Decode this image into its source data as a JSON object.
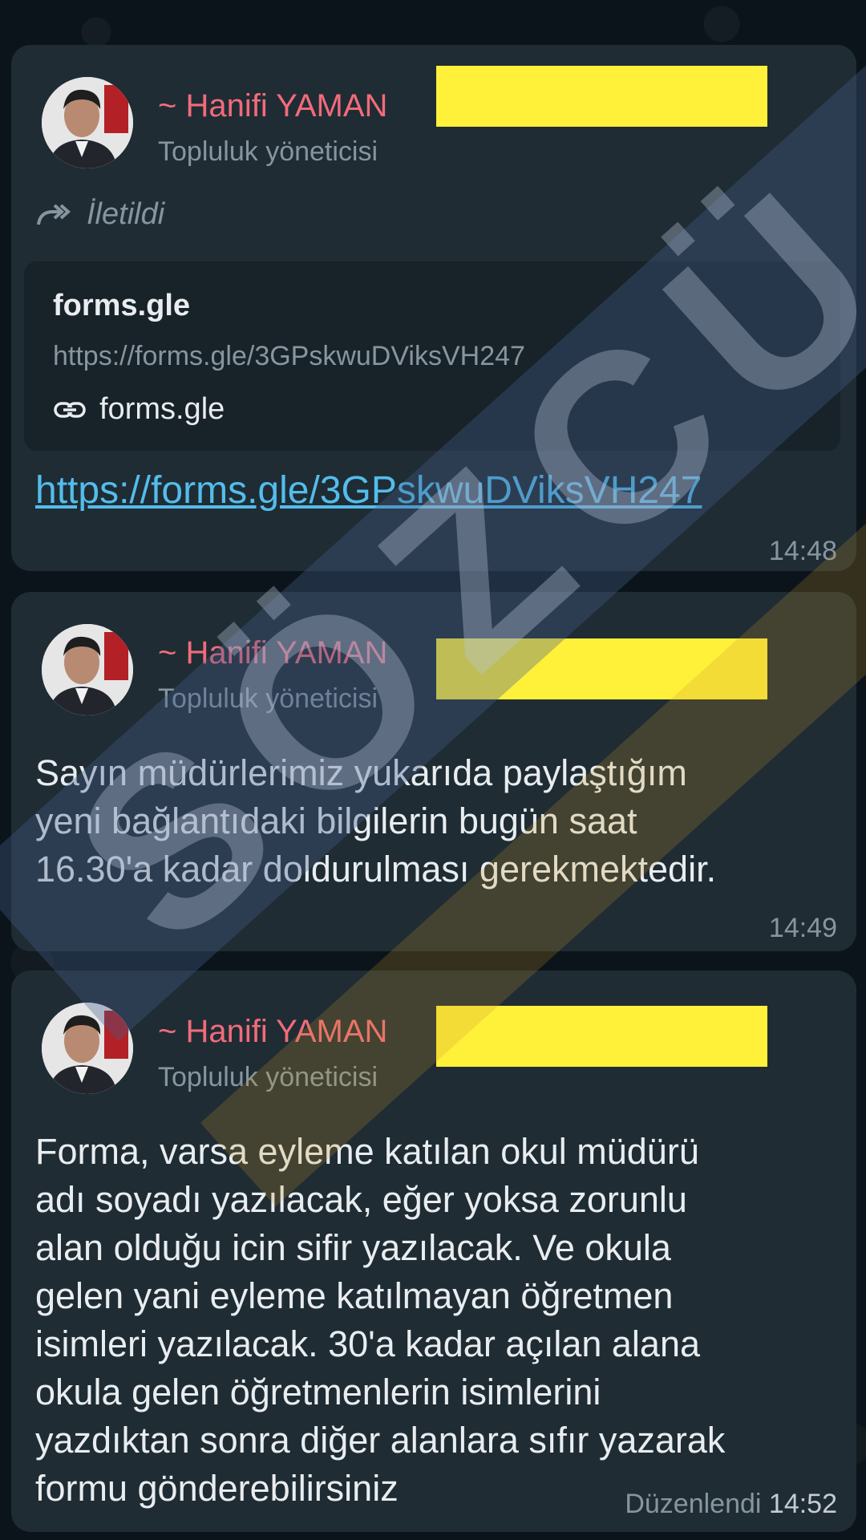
{
  "messages": [
    {
      "sender": "~ Hanifi YAMAN",
      "role": "Topluluk yöneticisi",
      "forwarded_label": "İletildi",
      "link_preview": {
        "title": "forms.gle",
        "url": "https://forms.gle/3GPskwuDViksVH247",
        "domain": "forms.gle"
      },
      "link_text": "https://forms.gle/3GPskwuDViksVH247",
      "time": "14:48"
    },
    {
      "sender": "~ Hanifi YAMAN",
      "role": "Topluluk yöneticisi",
      "text": "Sayın müdürlerimiz yukarıda paylaştığım\nyeni bağlantıdaki bilgilerin bugün saat\n16.30'a kadar doldurulması gerekmektedir.",
      "time": "14:49"
    },
    {
      "sender": "~ Hanifi YAMAN",
      "role": "Topluluk yöneticisi",
      "text": "Forma, varsa eyleme katılan okul müdürü\nadı soyadı yazılacak, eğer yoksa zorunlu\nalan olduğu icin sifir yazılacak. Ve okula\ngelen yani eyleme katılmayan öğretmen\nisimleri yazılacak. 30'a kadar açılan alana\nokula gelen  öğretmenlerin isimlerini\nyazdıktan sonra diğer alanlara sıfır yazarak\nformu gönderebilirsiniz",
      "edited_label": "Düzenlendi",
      "time": "14:52"
    }
  ],
  "watermark_text": "SÖZCÜ",
  "colors": {
    "background": "#0b141a",
    "bubble": "#1f2c34",
    "sender_name": "#f26b7a",
    "link": "#53bdeb",
    "meta": "#8696a0",
    "redaction": "#fff03a"
  }
}
